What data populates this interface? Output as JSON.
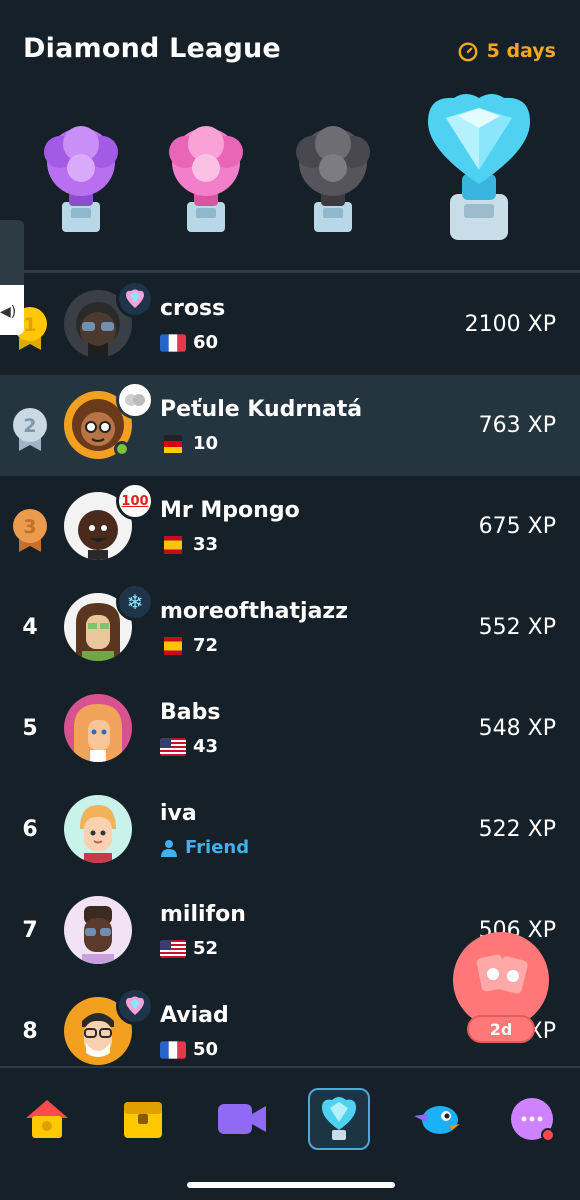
{
  "header": {
    "title": "Diamond League",
    "timer_label": "5 days",
    "accent_color": "#f5a623"
  },
  "trophies": [
    {
      "name": "amethyst-trophy-icon",
      "color": "#b86ff0"
    },
    {
      "name": "pearl-trophy-icon",
      "color": "#f27fc9"
    },
    {
      "name": "obsidian-trophy-icon",
      "color": "#6b6b70"
    },
    {
      "name": "diamond-trophy-icon",
      "color": "#4fd2f2"
    }
  ],
  "leaderboard": [
    {
      "rank": "1",
      "name": "cross",
      "flag": "france",
      "streak": "60",
      "xp": "2100 XP"
    },
    {
      "rank": "2",
      "name": "Peťule Kudrnatá",
      "flag": "germany",
      "streak": "10",
      "xp": "763 XP"
    },
    {
      "rank": "3",
      "name": "Mr Mpongo",
      "flag": "spain",
      "streak": "33",
      "xp": "675 XP"
    },
    {
      "rank": "4",
      "name": "moreofthatjazz",
      "flag": "spain",
      "streak": "72",
      "xp": "552 XP"
    },
    {
      "rank": "5",
      "name": "Babs",
      "flag": "usa",
      "streak": "43",
      "xp": "548 XP"
    },
    {
      "rank": "6",
      "name": "iva",
      "subtitle": "Friend",
      "xp": "522 XP"
    },
    {
      "rank": "7",
      "name": "milifon",
      "flag": "usa",
      "streak": "52",
      "xp": "506 XP"
    },
    {
      "rank": "8",
      "name": "Aviad",
      "flag": "france",
      "streak": "50",
      "xp": "XP"
    }
  ],
  "fab": {
    "label": "2d",
    "color": "#ff7878"
  },
  "nav": [
    "home-icon",
    "chest-icon",
    "video-icon",
    "leaderboard-icon",
    "duo-bird-icon",
    "more-icon"
  ]
}
